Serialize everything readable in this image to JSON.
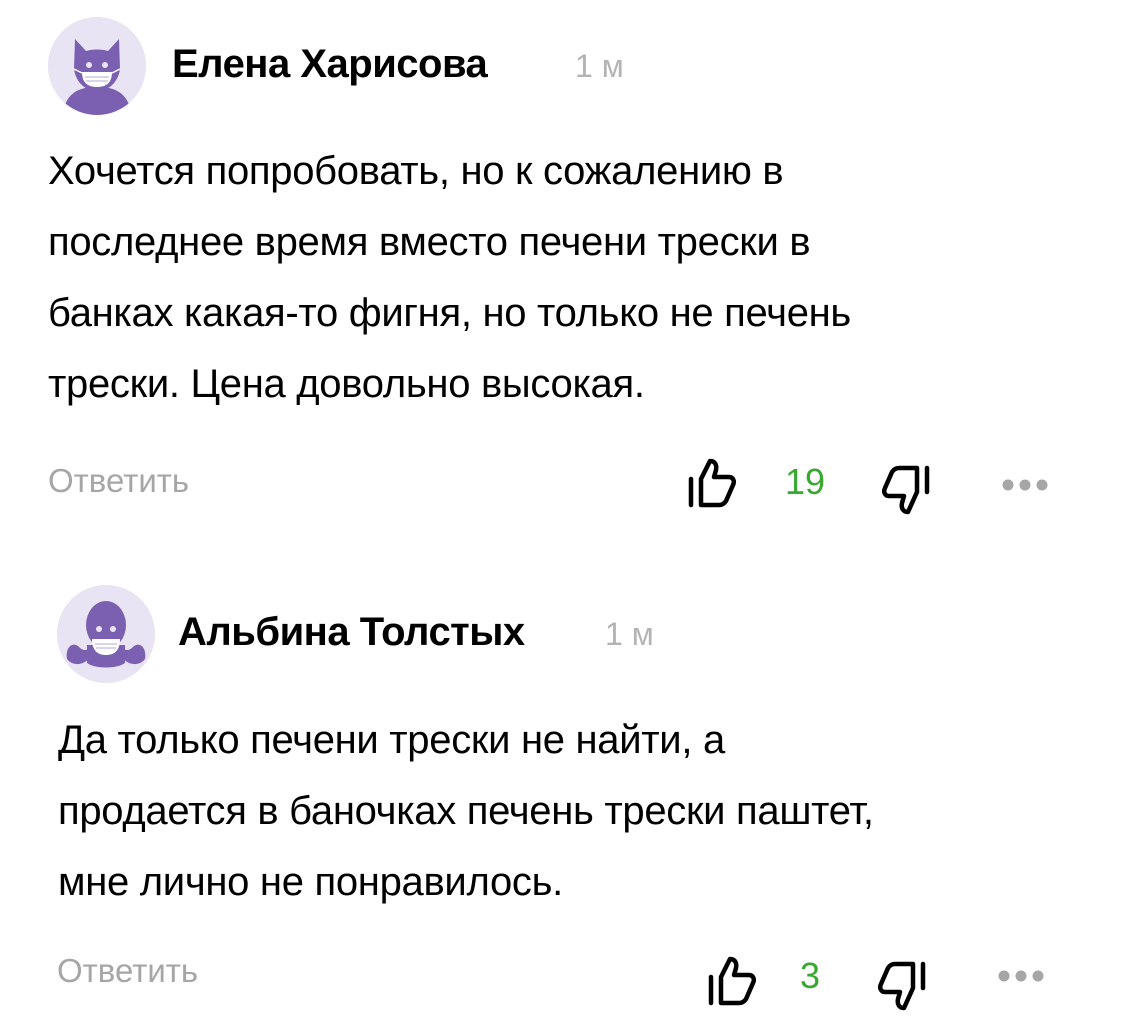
{
  "comments": [
    {
      "author": "Елена Харисова",
      "time": "1 м",
      "avatar_icon": "cat-mask-avatar",
      "text_lines": [
        "Хочется попробовать, но к сожалению в",
        "последнее время вместо печени трески в",
        "банках какая-то фигня, но только не печень",
        "трески. Цена довольно высокая."
      ],
      "reply_label": "Ответить",
      "likes": "19",
      "like_icon": "thumbs-up-icon",
      "dislike_icon": "thumbs-down-icon",
      "more_icon": "more-dots-icon"
    },
    {
      "author": "Альбина Толстых",
      "time": "1 м",
      "avatar_icon": "octopus-mask-avatar",
      "text_lines": [
        "Да только печени трески не найти, а",
        "продается в баночках печень трески паштет,",
        "мне лично не понравилось."
      ],
      "reply_label": "Ответить",
      "likes": "3",
      "like_icon": "thumbs-up-icon",
      "dislike_icon": "thumbs-down-icon",
      "more_icon": "more-dots-icon"
    }
  ],
  "colors": {
    "avatar_accent": "#7b5fb0",
    "avatar_bg": "#e9e4f3",
    "like_count": "#39a830",
    "muted": "#a6a6a6"
  }
}
